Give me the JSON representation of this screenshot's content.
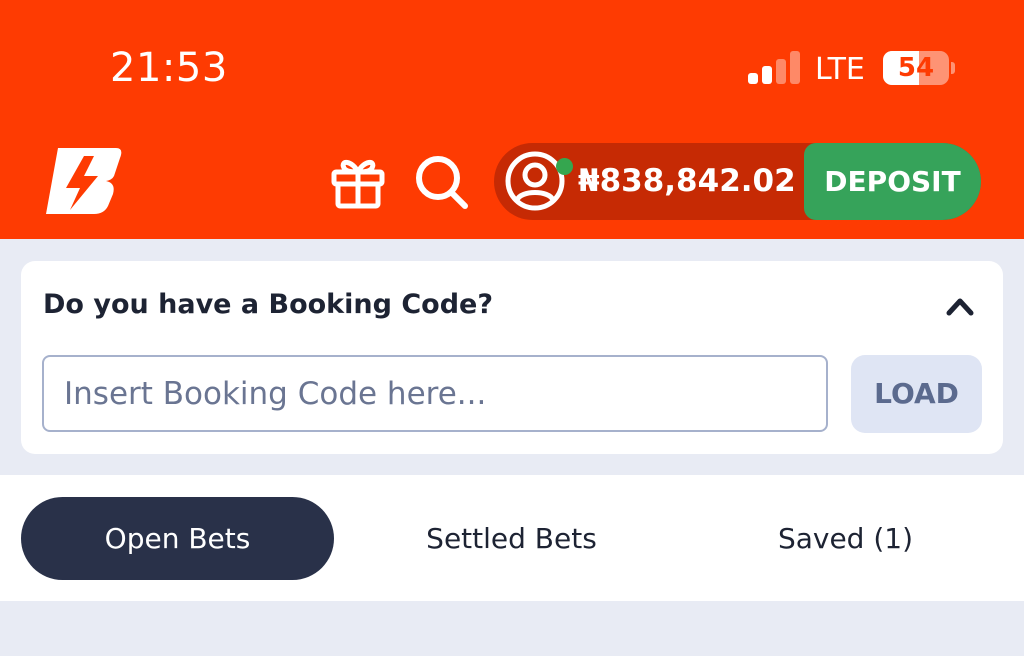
{
  "status_bar": {
    "time": "21:53",
    "network": "LTE",
    "battery": "54",
    "battery_level": 0.54,
    "signal_bars_active": 2,
    "signal_bars_total": 4
  },
  "header": {
    "logo_icon": "lightning-b-logo",
    "gift_icon": "gift-icon",
    "search_icon": "search-icon",
    "account_icon": "user-circle-icon",
    "balance": "₦838,842.02",
    "deposit_label": "DEPOSIT"
  },
  "booking": {
    "title": "Do you have a Booking Code?",
    "collapse_icon": "chevron-up-icon",
    "placeholder": "Insert Booking Code here...",
    "value": "",
    "load_label": "LOAD"
  },
  "tabs": [
    {
      "label": "Open Bets",
      "active": true
    },
    {
      "label": "Settled Bets",
      "active": false
    },
    {
      "label": "Saved (1)",
      "active": false
    }
  ],
  "colors": {
    "brand": "#fe3b02",
    "pill": "#c62a04",
    "deposit": "#36a35a",
    "online": "#35a64f",
    "tab_active": "#293149",
    "page_bg": "#e8ebf4"
  }
}
